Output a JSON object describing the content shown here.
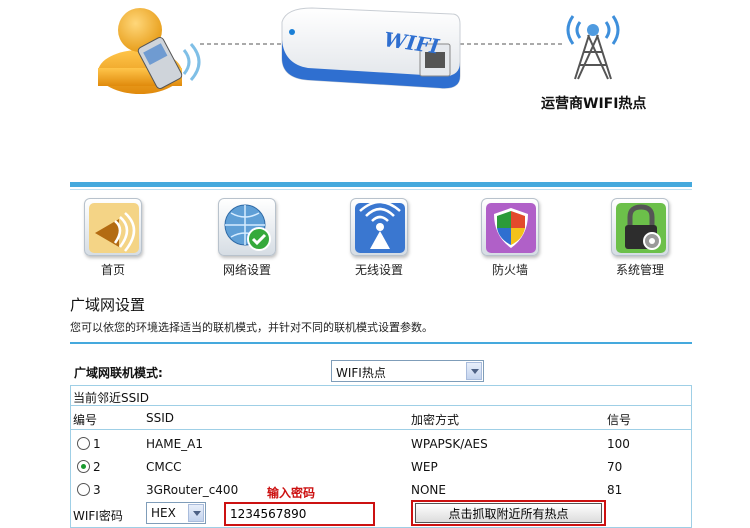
{
  "hero": {
    "device_label": "WIFI",
    "carrier_label": "运营商WIFI热点"
  },
  "nav": {
    "items": [
      {
        "label": "首页",
        "icon": "home-icon"
      },
      {
        "label": "网络设置",
        "icon": "globe-check-icon"
      },
      {
        "label": "无线设置",
        "icon": "wireless-signal-icon"
      },
      {
        "label": "防火墙",
        "icon": "shield-firewall-icon"
      },
      {
        "label": "系统管理",
        "icon": "lock-gear-icon"
      }
    ]
  },
  "section": {
    "title": "广域网设置",
    "description": "您可以依您的环境选择适当的联机模式，并针对不同的联机模式设置参数。"
  },
  "wan": {
    "mode_label": "广域网联机模式:",
    "mode_value": "WIFI热点"
  },
  "ssid_table": {
    "heading": "当前邻近SSID",
    "columns": {
      "no": "编号",
      "ssid": "SSID",
      "encryption": "加密方式",
      "signal": "信号"
    },
    "rows": [
      {
        "no": "1",
        "ssid": "HAME_A1",
        "encryption": "WPAPSK/AES",
        "signal": "100",
        "selected": false
      },
      {
        "no": "2",
        "ssid": "CMCC",
        "encryption": "WEP",
        "signal": "70",
        "selected": true
      },
      {
        "no": "3",
        "ssid": "3GRouter_c400",
        "encryption": "NONE",
        "signal": "81",
        "selected": false
      }
    ]
  },
  "password": {
    "label": "WIFI密码",
    "key_format": "HEX",
    "value": "1234567890",
    "hint": "输入密码"
  },
  "scan_button_label": "点击抓取附近所有热点",
  "colors": {
    "accent": "#45a9dd",
    "highlight": "#cc1111",
    "table_border": "#9fcfe6"
  }
}
